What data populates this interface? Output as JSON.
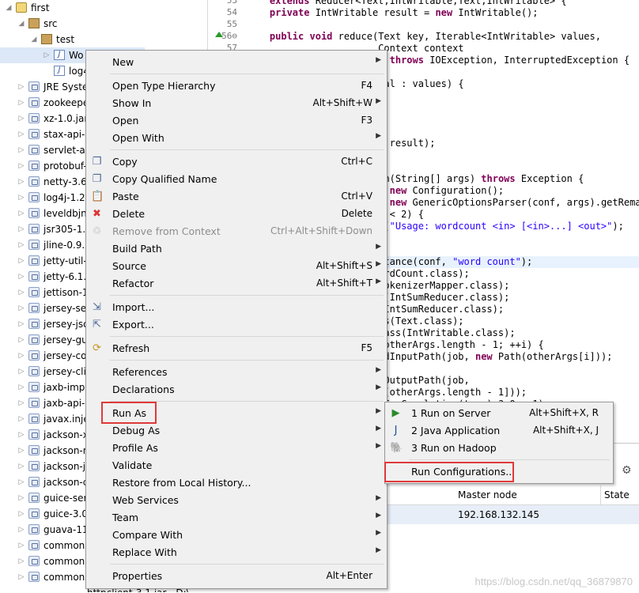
{
  "tree": {
    "rows": [
      {
        "label": "first",
        "indent": 0,
        "arrow": "◢",
        "icon": "prj"
      },
      {
        "label": "src",
        "indent": 1,
        "arrow": "◢",
        "icon": "pkg"
      },
      {
        "label": "test",
        "indent": 2,
        "arrow": "◢",
        "icon": "pkg"
      },
      {
        "label": "Wo",
        "indent": 3,
        "arrow": "▷",
        "icon": "jfile",
        "selected": true
      },
      {
        "label": "log4j.p",
        "indent": 3,
        "arrow": "",
        "icon": "jfile"
      },
      {
        "label": "JRE Syster",
        "indent": 1,
        "arrow": "▷",
        "icon": "jar"
      },
      {
        "label": "zookeepe",
        "indent": 1,
        "arrow": "▷",
        "icon": "jar"
      },
      {
        "label": "xz-1.0.jar -",
        "indent": 1,
        "arrow": "▷",
        "icon": "jar"
      },
      {
        "label": "stax-api-1.",
        "indent": 1,
        "arrow": "▷",
        "icon": "jar"
      },
      {
        "label": "servlet-api",
        "indent": 1,
        "arrow": "▷",
        "icon": "jar"
      },
      {
        "label": "protobuf-j",
        "indent": 1,
        "arrow": "▷",
        "icon": "jar"
      },
      {
        "label": "netty-3.6.2",
        "indent": 1,
        "arrow": "▷",
        "icon": "jar"
      },
      {
        "label": "log4j-1.2.1",
        "indent": 1,
        "arrow": "▷",
        "icon": "jar"
      },
      {
        "label": "leveldbjni-",
        "indent": 1,
        "arrow": "▷",
        "icon": "jar"
      },
      {
        "label": "jsr305-1.3.",
        "indent": 1,
        "arrow": "▷",
        "icon": "jar"
      },
      {
        "label": "jline-0.9.94",
        "indent": 1,
        "arrow": "▷",
        "icon": "jar"
      },
      {
        "label": "jetty-util-6",
        "indent": 1,
        "arrow": "▷",
        "icon": "jar"
      },
      {
        "label": "jetty-6.1.26",
        "indent": 1,
        "arrow": "▷",
        "icon": "jar"
      },
      {
        "label": "jettison-1.1",
        "indent": 1,
        "arrow": "▷",
        "icon": "jar"
      },
      {
        "label": "jersey-serv",
        "indent": 1,
        "arrow": "▷",
        "icon": "jar"
      },
      {
        "label": "jersey-json",
        "indent": 1,
        "arrow": "▷",
        "icon": "jar"
      },
      {
        "label": "jersey-guic",
        "indent": 1,
        "arrow": "▷",
        "icon": "jar"
      },
      {
        "label": "jersey-core",
        "indent": 1,
        "arrow": "▷",
        "icon": "jar"
      },
      {
        "label": "jersey-clier",
        "indent": 1,
        "arrow": "▷",
        "icon": "jar"
      },
      {
        "label": "jaxb-impl-",
        "indent": 1,
        "arrow": "▷",
        "icon": "jar"
      },
      {
        "label": "jaxb-api-2.",
        "indent": 1,
        "arrow": "▷",
        "icon": "jar"
      },
      {
        "label": "javax.injec",
        "indent": 1,
        "arrow": "▷",
        "icon": "jar"
      },
      {
        "label": "jackson-xc",
        "indent": 1,
        "arrow": "▷",
        "icon": "jar"
      },
      {
        "label": "jackson-m",
        "indent": 1,
        "arrow": "▷",
        "icon": "jar"
      },
      {
        "label": "jackson-jax",
        "indent": 1,
        "arrow": "▷",
        "icon": "jar"
      },
      {
        "label": "jackson-co",
        "indent": 1,
        "arrow": "▷",
        "icon": "jar"
      },
      {
        "label": "guice-servl",
        "indent": 1,
        "arrow": "▷",
        "icon": "jar"
      },
      {
        "label": "guice-3.0.ja",
        "indent": 1,
        "arrow": "▷",
        "icon": "jar"
      },
      {
        "label": "guava-11.0",
        "indent": 1,
        "arrow": "▷",
        "icon": "jar"
      },
      {
        "label": "commons-",
        "indent": 1,
        "arrow": "▷",
        "icon": "jar"
      },
      {
        "label": "commons-",
        "indent": 1,
        "arrow": "▷",
        "icon": "jar"
      },
      {
        "label": "commons-",
        "indent": 1,
        "arrow": "▷",
        "icon": "jar"
      }
    ],
    "partial_last": "httpclient-3.1.jar - D:\\"
  },
  "editor": {
    "lines": [
      {
        "n": "53",
        "text": "    extends Reducer<Text,IntWritable,Text,IntWritable> {"
      },
      {
        "n": "54",
        "text": "    private IntWritable result = new IntWritable();"
      },
      {
        "n": "55",
        "text": ""
      },
      {
        "n": "56⊖",
        "text": "    public void reduce(Text key, Iterable<IntWritable> values,"
      },
      {
        "n": "57",
        "text": "                       Context context"
      },
      {
        "n": "",
        "text": "                       ) throws IOException, InterruptedException {"
      },
      {
        "n": "",
        "text": ""
      },
      {
        "n": "",
        "text": "      for (IntWritable val : values) {"
      },
      {
        "n": "",
        "text": ""
      },
      {
        "n": "",
        "text": ""
      },
      {
        "n": "",
        "text": ""
      },
      {
        "n": "",
        "text": "      result.set(sum);"
      },
      {
        "n": "",
        "text": "      context.write(key, result);"
      },
      {
        "n": "",
        "text": ""
      },
      {
        "n": "",
        "text": ""
      },
      {
        "n": "",
        "text": "  public static void main(String[] args) throws Exception {"
      },
      {
        "n": "",
        "text": "    Configuration conf = new Configuration();"
      },
      {
        "n": "",
        "text": "    String[] otherArgs = new GenericOptionsParser(conf, args).getRemain"
      },
      {
        "n": "",
        "text": "    if (otherArgs.length < 2) {"
      },
      {
        "n": "",
        "text": "      System.err.println(\"Usage: wordcount <in> [<in>...] <out>\");"
      },
      {
        "n": "",
        "text": ""
      },
      {
        "n": "",
        "text": ""
      },
      {
        "n": "",
        "text": "    Job job = Job.getInstance(conf, \"word count\");"
      },
      {
        "n": "",
        "text": "    job.setJarByClass(WordCount.class);"
      },
      {
        "n": "",
        "text": "    job.setMapperClass(TokenizerMapper.class);"
      },
      {
        "n": "",
        "text": "    job.setCombinerClass(IntSumReducer.class);"
      },
      {
        "n": "",
        "text": "    job.setReducerClass(IntSumReducer.class);"
      },
      {
        "n": "",
        "text": "    job.setOutputKeyClass(Text.class);"
      },
      {
        "n": "",
        "text": "    job.setOutputValueClass(IntWritable.class);"
      },
      {
        "n": "",
        "text": "    for (int i = 0; i < otherArgs.length - 1; ++i) {"
      },
      {
        "n": "",
        "text": "      FileInputFormat.addInputPath(job, new Path(otherArgs[i]));"
      },
      {
        "n": "",
        "text": ""
      },
      {
        "n": "",
        "text": "    FileOutputFormat.setOutputPath(job,"
      },
      {
        "n": "",
        "text": "      new Path(otherArgs[otherArgs.length - 1]));"
      },
      {
        "n": "",
        "text": "    System.exit(job.waitForCompletion(true) ? 0 : 1);"
      }
    ]
  },
  "bottom": {
    "col_master": "Master node",
    "col_state": "State",
    "master_value": "192.168.132.145"
  },
  "menu": {
    "items": [
      {
        "label": "New",
        "acc": "",
        "sub": true,
        "icon": ""
      },
      {
        "sep": true
      },
      {
        "label": "Open Type Hierarchy",
        "acc": "F4",
        "sub": false,
        "icon": ""
      },
      {
        "label": "Show In",
        "acc": "Alt+Shift+W",
        "sub": true,
        "icon": ""
      },
      {
        "label": "Open",
        "acc": "F3",
        "sub": false,
        "icon": ""
      },
      {
        "label": "Open With",
        "acc": "",
        "sub": true,
        "icon": ""
      },
      {
        "sep": true
      },
      {
        "label": "Copy",
        "acc": "Ctrl+C",
        "sub": false,
        "icon": "copy-icon"
      },
      {
        "label": "Copy Qualified Name",
        "acc": "",
        "sub": false,
        "icon": "copy-qualified-icon"
      },
      {
        "label": "Paste",
        "acc": "Ctrl+V",
        "sub": false,
        "icon": "paste-icon"
      },
      {
        "label": "Delete",
        "acc": "Delete",
        "sub": false,
        "icon": "delete-icon"
      },
      {
        "label": "Remove from Context",
        "acc": "Ctrl+Alt+Shift+Down",
        "sub": false,
        "icon": "remove-context-icon",
        "disabled": true
      },
      {
        "label": "Build Path",
        "acc": "",
        "sub": true,
        "icon": ""
      },
      {
        "label": "Source",
        "acc": "Alt+Shift+S",
        "sub": true,
        "icon": ""
      },
      {
        "label": "Refactor",
        "acc": "Alt+Shift+T",
        "sub": true,
        "icon": ""
      },
      {
        "sep": true
      },
      {
        "label": "Import...",
        "acc": "",
        "sub": false,
        "icon": "import-icon"
      },
      {
        "label": "Export...",
        "acc": "",
        "sub": false,
        "icon": "export-icon"
      },
      {
        "sep": true
      },
      {
        "label": "Refresh",
        "acc": "F5",
        "sub": false,
        "icon": "refresh-icon"
      },
      {
        "sep": true
      },
      {
        "label": "References",
        "acc": "",
        "sub": true,
        "icon": ""
      },
      {
        "label": "Declarations",
        "acc": "",
        "sub": true,
        "icon": ""
      },
      {
        "sep": true
      },
      {
        "label": "Run As",
        "acc": "",
        "sub": true,
        "icon": "",
        "highlight": true
      },
      {
        "label": "Debug As",
        "acc": "",
        "sub": true,
        "icon": ""
      },
      {
        "label": "Profile As",
        "acc": "",
        "sub": true,
        "icon": ""
      },
      {
        "label": "Validate",
        "acc": "",
        "sub": false,
        "icon": ""
      },
      {
        "label": "Restore from Local History...",
        "acc": "",
        "sub": false,
        "icon": ""
      },
      {
        "label": "Web Services",
        "acc": "",
        "sub": true,
        "icon": ""
      },
      {
        "label": "Team",
        "acc": "",
        "sub": true,
        "icon": ""
      },
      {
        "label": "Compare With",
        "acc": "",
        "sub": true,
        "icon": ""
      },
      {
        "label": "Replace With",
        "acc": "",
        "sub": true,
        "icon": ""
      },
      {
        "sep": true
      },
      {
        "label": "Properties",
        "acc": "Alt+Enter",
        "sub": false,
        "icon": ""
      }
    ]
  },
  "submenu": {
    "items": [
      {
        "label": "1 Run on Server",
        "acc": "Alt+Shift+X, R",
        "icon": "run-server-icon"
      },
      {
        "label": "2 Java Application",
        "acc": "Alt+Shift+X, J",
        "icon": "java-app-icon"
      },
      {
        "label": "3 Run on Hadoop",
        "acc": "",
        "icon": "hadoop-elephant-icon"
      },
      {
        "sep": true
      },
      {
        "label": "Run Configurations...",
        "acc": "",
        "icon": "",
        "highlight": true
      }
    ]
  },
  "watermark": "https://blog.csdn.net/qq_36879870",
  "colors": {
    "highlight_box": "#e0393a",
    "menu_bg": "#f0f0f0"
  }
}
